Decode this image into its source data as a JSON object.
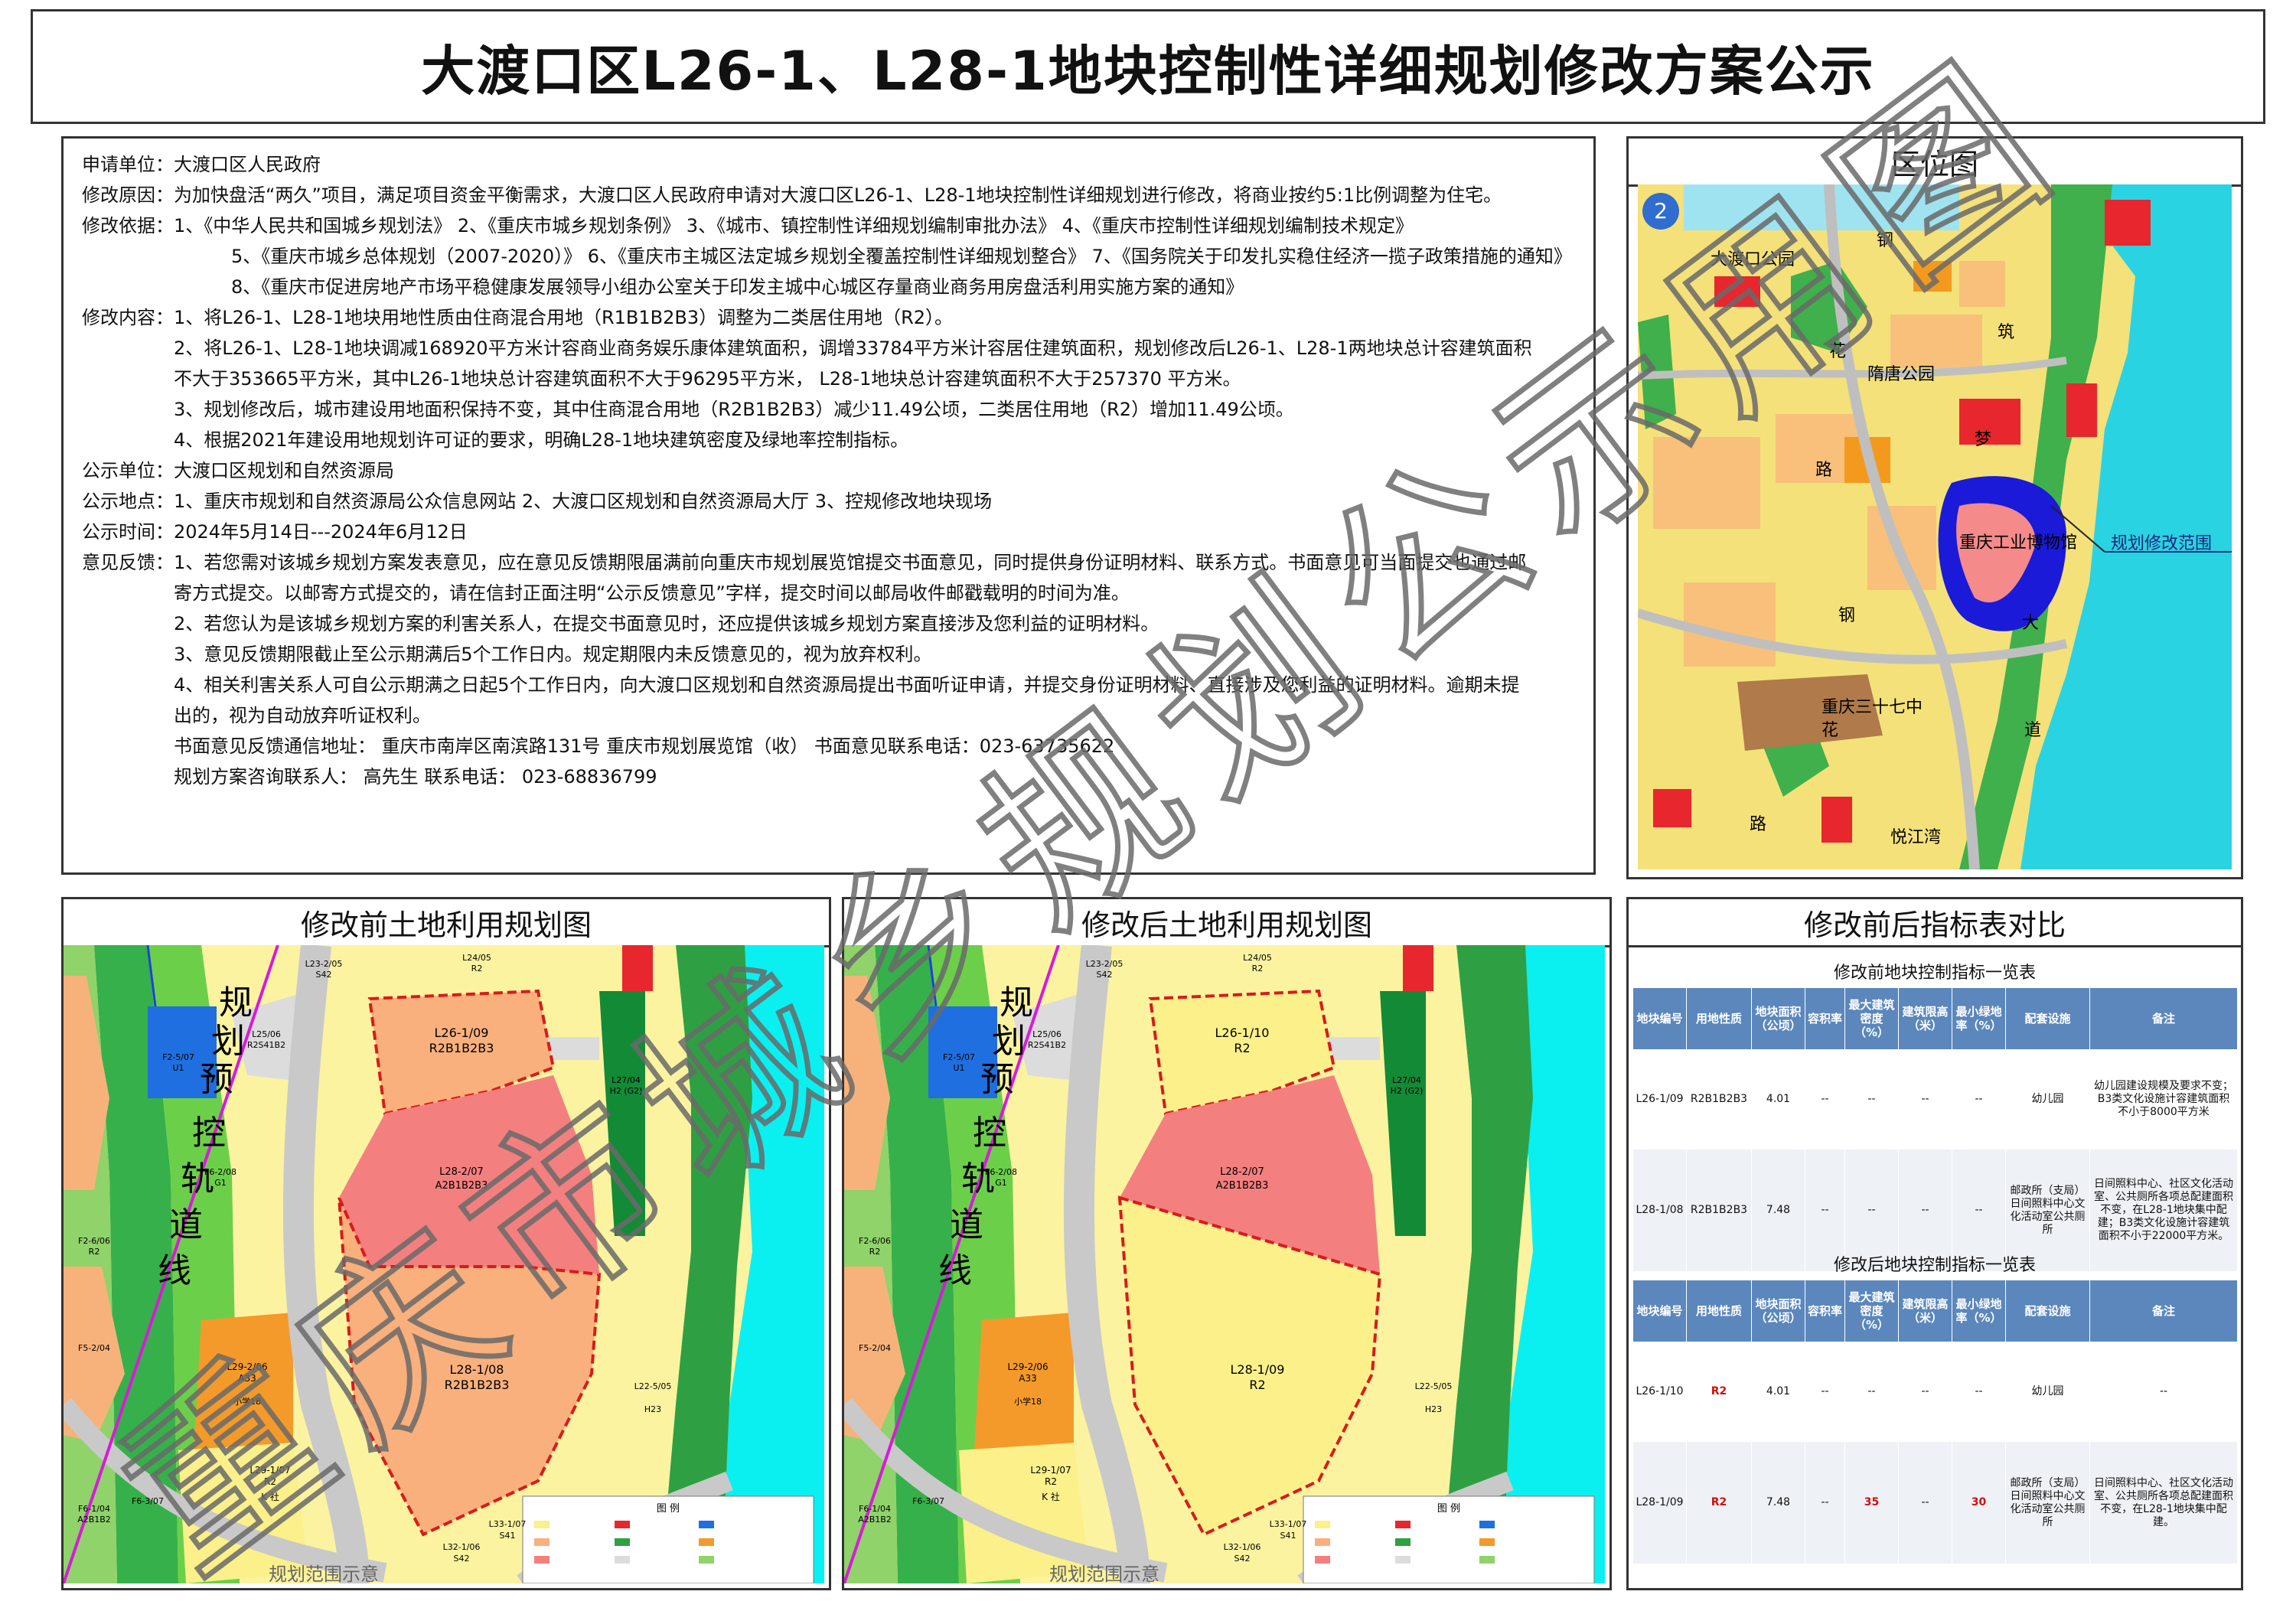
{
  "title": "大渡口区L26-1、L28-1地块控制性详细规划修改方案公示",
  "notice": {
    "applicant_label": "申请单位：",
    "applicant": "大渡口区人民政府",
    "reason_label": "修改原因：",
    "reason": "为加快盘活“两久”项目，满足项目资金平衡需求，大渡口区人民政府申请对大渡口区L26-1、L28-1地块控制性详细规划进行修改，将商业按约5:1比例调整为住宅。",
    "basis_label": "修改依据：",
    "basis_lines": [
      "1、《中华人民共和国城乡规划法》 2、《重庆市城乡规划条例》  3、《城市、镇控制性详细规划编制审批办法》 4、《重庆市控制性详细规划编制技术规定》",
      "5、《重庆市城乡总体规划（2007-2020）》 6、《重庆市主城区法定城乡规划全覆盖控制性详细规划整合》 7、《国务院关于印发扎实稳住经济一揽子政策措施的通知》",
      "8、《重庆市促进房地产市场平稳健康发展领导小组办公室关于印发主城中心城区存量商业商务用房盘活利用实施方案的通知》"
    ],
    "content_label": "修改内容：",
    "content_lines": [
      "1、将L26-1、L28-1地块用地性质由住商混合用地（R1B1B2B3）调整为二类居住用地（R2）。",
      "2、将L26-1、L28-1地块调减168920平方米计容商业商务娱乐康体建筑面积，调增33784平方米计容居住建筑面积，规划修改后L26-1、L28-1两地块总计容建筑面积",
      "不大于353665平方米，其中L26-1地块总计容建筑面积不大于96295平方米， L28-1地块总计容建筑面积不大于257370 平方米。",
      "3、规划修改后，城市建设用地面积保持不变，其中住商混合用地（R2B1B2B3）减少11.49公顷，二类居住用地（R2）增加11.49公顷。",
      "4、根据2021年建设用地规划许可证的要求，明确L28-1地块建筑密度及绿地率控制指标。"
    ],
    "unit_label": "公示单位：",
    "unit": "大渡口区规划和自然资源局",
    "place_label": "公示地点：",
    "place": "1、重庆市规划和自然资源局公众信息网站  2、大渡口区规划和自然资源局大厅  3、控规修改地块现场",
    "time_label": "公示时间：",
    "time": "2024年5月14日---2024年6月12日",
    "feedback_label": "意见反馈：",
    "feedback_lines": [
      "1、若您需对该城乡规划方案发表意见，应在意见反馈期限届满前向重庆市规划展览馆提交书面意见，同时提供身份证明材料、联系方式。书面意见可当面提交也通过邮",
      "寄方式提交。以邮寄方式提交的，请在信封正面注明“公示反馈意见”字样，提交时间以邮局收件邮戳载明的时间为准。",
      "2、若您认为是该城乡规划方案的利害关系人，在提交书面意见时，还应提供该城乡规划方案直接涉及您利益的证明材料。",
      "3、意见反馈期限截止至公示期满后5个工作日内。规定期限内未反馈意见的，视为放弃权利。",
      "4、相关利害关系人可自公示期满之日起5个工作日内，向大渡口区规划和自然资源局提出书面听证申请，并提交身份证明材料、直接涉及您利益的证明材料。逾期未提",
      "出的，视为自动放弃听证权利。"
    ],
    "address_line": "书面意见反馈通信地址：  重庆市南岸区南滨路131号    重庆市规划展览馆（收）      书面意见联系电话：023-63735622",
    "contact_line": "规划方案咨询联系人：  高先生            联系电话：  023-68836799"
  },
  "location_map": {
    "title": "区位图",
    "badge": "2",
    "labels": {
      "park1": "大渡口公园",
      "park2": "隋唐公园",
      "museum": "重庆工业博物馆",
      "school": "重庆三十七中",
      "bay": "悦江湾",
      "road1": "钢",
      "road2": "花",
      "road3": "路",
      "road4": "钢",
      "road5": "花",
      "road6": "路",
      "road7": "筑",
      "road8": "梦",
      "road9": "大",
      "road10": "道",
      "range": "规划修改范围"
    }
  },
  "before_map": {
    "title": "修改前土地利用规划图",
    "rail": [
      "规",
      "划",
      "预",
      "控",
      "轨",
      "道",
      "线"
    ],
    "plots": {
      "l26": "L26-1/09",
      "l26_use": "R2B1B2B3",
      "l28_2": "L28-2/07",
      "l28_2_use": "A2B1B2B3",
      "l28_1": "L28-1/08",
      "l28_1_use": "R2B1B2B3",
      "l29_2": "L29-2/06",
      "l29_2_use": "A33",
      "l29_2_sub": "小学18",
      "l29_1": "L29-1/07",
      "l29_1_use": "R2",
      "l25": "L25/06",
      "l25_use": "R2S41B2",
      "l24": "L24/05",
      "l24_use": "R2",
      "l23": "L23-2/05",
      "l23_use": "S42",
      "l27": "L27/04",
      "l27_use": "H2 (G2)",
      "l22": "L22-5/05",
      "l22_use": "H23",
      "l32": "L32-1/06",
      "l32_use": "S42",
      "l33": "L33-1/07",
      "l33_use": "S41",
      "f2_5": "F2-5/07",
      "f2_5_use": "U1",
      "f6_2": "F6-2/08",
      "f6_2_use": "G1",
      "f2_6": "F2-6/06",
      "f2_6_use": "R2",
      "f5_2": "F5-2/04",
      "f6_3": "F6-3/07",
      "f6_1": "F6-1/04",
      "f6_1_use": "A2B1B2",
      "k_label": "K 社",
      "legend": "图 例",
      "footer": "规划范围示意"
    }
  },
  "after_map": {
    "title": "修改后土地利用规划图",
    "rail": [
      "规",
      "划",
      "预",
      "控",
      "轨",
      "道",
      "线"
    ],
    "plots": {
      "l26": "L26-1/10",
      "l26_use": "R2",
      "l28_2": "L28-2/07",
      "l28_2_use": "A2B1B2B3",
      "l28_1": "L28-1/09",
      "l28_1_use": "R2",
      "l29_2": "L29-2/06",
      "l29_2_use": "A33",
      "l29_2_sub": "小学18",
      "l29_1": "L29-1/07",
      "l29_1_use": "R2",
      "l25": "L25/06",
      "l25_use": "R2S41B2",
      "l24": "L24/05",
      "l24_use": "R2",
      "l23": "L23-2/05",
      "l23_use": "S42",
      "l27": "L27/04",
      "l27_use": "H2 (G2)",
      "l22": "L22-5/05",
      "l22_use": "H23",
      "l32": "L32-1/06",
      "l32_use": "S42",
      "l33": "L33-1/07",
      "l33_use": "S41",
      "f2_5": "F2-5/07",
      "f2_5_use": "U1",
      "f6_2": "F6-2/08",
      "f6_2_use": "G1",
      "f2_6": "F2-6/06",
      "f2_6_use": "R2",
      "f5_2": "F5-2/04",
      "f6_3": "F6-3/07",
      "f6_1": "F6-1/04",
      "f6_1_use": "A2B1B2",
      "k_label": "K 社",
      "legend": "图 例",
      "footer": "规划范围示意"
    }
  },
  "comparison": {
    "title": "修改前后指标表对比",
    "before_caption": "修改前地块控制指标一览表",
    "after_caption": "修改后地块控制指标一览表",
    "headers": [
      "地块编号",
      "用地性质",
      "地块面积（公顷）",
      "容积率",
      "最大建筑密度（%）",
      "建筑限高（米）",
      "最小绿地率（%）",
      "配套设施",
      "备注"
    ],
    "before_rows": [
      [
        "L26-1/09",
        "R2B1B2B3",
        "4.01",
        "--",
        "--",
        "--",
        "--",
        "幼儿园",
        "幼儿园建设规模及要求不变；B3类文化设施计容建筑面积不小于8000平方米"
      ],
      [
        "L28-1/08",
        "R2B1B2B3",
        "7.48",
        "--",
        "--",
        "--",
        "--",
        "邮政所（支局）日间照料中心文化活动室公共厕所",
        "日间照料中心、社区文化活动室、公共厕所各项总配建面积不变，在L28-1地块集中配建；B3类文化设施计容建筑面积不小于22000平方米。"
      ]
    ],
    "after_rows": [
      [
        "L26-1/10",
        "R2",
        "4.01",
        "--",
        "--",
        "--",
        "--",
        "幼儿园",
        "--"
      ],
      [
        "L28-1/09",
        "R2",
        "7.48",
        "--",
        "35",
        "--",
        "30",
        "邮政所（支局）日间照料中心文化活动室公共厕所",
        "日间照料中心、社区文化活动室、公共厕所各项总配建面积不变，在L28-1地块集中配建。"
      ]
    ]
  },
  "watermark": "重庆市城乡规划公示用图"
}
